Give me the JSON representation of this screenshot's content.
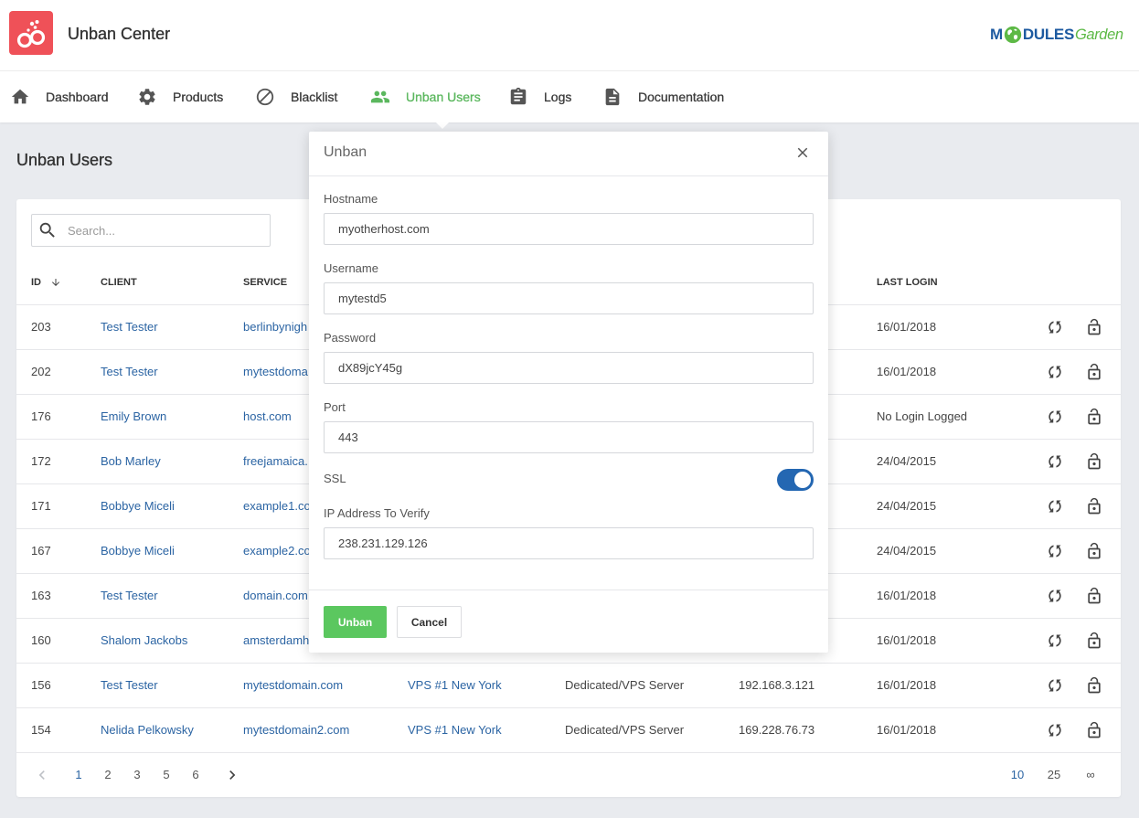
{
  "app": {
    "title": "Unban Center",
    "icon": "handcuffs-icon"
  },
  "logo": {
    "text_m": "M",
    "o_icon": "globe-icon",
    "text_dules": "DULES",
    "text_garden": "Garden"
  },
  "nav": [
    {
      "label": "Dashboard",
      "icon": "home-icon"
    },
    {
      "label": "Products",
      "icon": "gear-icon"
    },
    {
      "label": "Blacklist",
      "icon": "ban-icon"
    },
    {
      "label": "Unban Users",
      "icon": "users-icon",
      "active": true
    },
    {
      "label": "Logs",
      "icon": "clipboard-icon"
    },
    {
      "label": "Documentation",
      "icon": "document-icon"
    }
  ],
  "page": {
    "title": "Unban Users"
  },
  "search": {
    "placeholder": "Search...",
    "icon": "search-icon"
  },
  "table": {
    "headers": {
      "id": "ID",
      "client": "CLIENT",
      "service": "SERVICE",
      "last_login": "LAST LOGIN"
    },
    "sort_icon": "arrow-down-icon",
    "row_actions": [
      "refresh-icon",
      "unlock-icon"
    ],
    "rows": [
      {
        "id": "203",
        "client": "Test Tester",
        "service": "berlinbynigh",
        "last_login": "16/01/2018"
      },
      {
        "id": "202",
        "client": "Test Tester",
        "service": "mytestdoma",
        "last_login": "16/01/2018"
      },
      {
        "id": "176",
        "client": "Emily Brown",
        "service": "host.com",
        "last_login": "No Login Logged"
      },
      {
        "id": "172",
        "client": "Bob Marley",
        "service": "freejamaica.",
        "last_login": "24/04/2015"
      },
      {
        "id": "171",
        "client": "Bobbye Miceli",
        "service": "example1.co",
        "last_login": "24/04/2015"
      },
      {
        "id": "167",
        "client": "Bobbye Miceli",
        "service": "example2.co",
        "last_login": "24/04/2015"
      },
      {
        "id": "163",
        "client": "Test Tester",
        "service": "domain.com",
        "last_login": "16/01/2018"
      },
      {
        "id": "160",
        "client": "Shalom Jackobs",
        "service": "amsterdamh",
        "last_login": "16/01/2018"
      },
      {
        "id": "156",
        "client": "Test Tester",
        "service": "mytestdomain.com",
        "product": "VPS #1 New York",
        "type": "Dedicated/VPS Server",
        "ip": "192.168.3.121",
        "last_login": "16/01/2018"
      },
      {
        "id": "154",
        "client": "Nelida Pelkowsky",
        "service": "mytestdomain2.com",
        "product": "VPS #1 New York",
        "type": "Dedicated/VPS Server",
        "ip": "169.228.76.73",
        "last_login": "16/01/2018"
      }
    ]
  },
  "pagination": {
    "pages": [
      {
        "label": "1",
        "active": true
      },
      {
        "label": "2"
      },
      {
        "label": "3"
      },
      {
        "label": "5"
      },
      {
        "label": "6"
      }
    ],
    "page_sizes": [
      {
        "label": "10",
        "active": true
      },
      {
        "label": "25"
      },
      {
        "label": "∞"
      }
    ]
  },
  "modal": {
    "title": "Unban",
    "fields": {
      "hostname": {
        "label": "Hostname",
        "value": "myotherhost.com"
      },
      "username": {
        "label": "Username",
        "value": "mytestd5"
      },
      "password": {
        "label": "Password",
        "value": "dX89jcY45g"
      },
      "port": {
        "label": "Port",
        "value": "443"
      },
      "ip_address": {
        "label": "IP Address To Verify",
        "value": "238.231.129.126"
      }
    },
    "ssl": {
      "label": "SSL",
      "enabled": true
    },
    "buttons": {
      "submit": "Unban",
      "cancel": "Cancel"
    }
  },
  "colors": {
    "brand_red": "#ef5158",
    "accent_green": "#5bb75e",
    "button_green": "#5bc75f",
    "link_blue": "#2b64a3",
    "toggle_blue": "#2467b2",
    "page_bg": "#e9ebef"
  }
}
